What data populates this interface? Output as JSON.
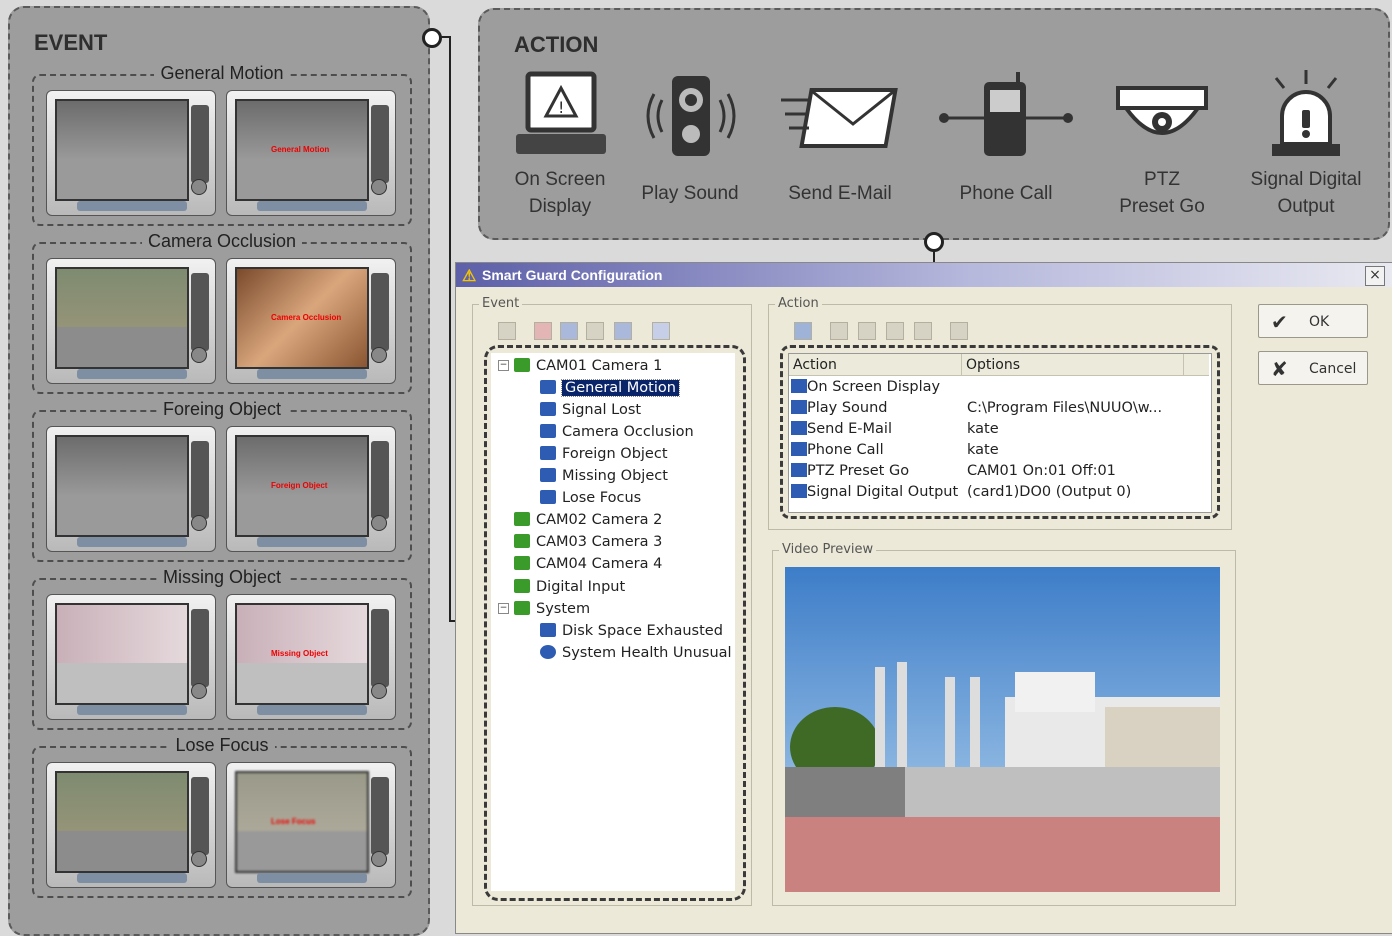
{
  "event_panel": {
    "title": "EVENT",
    "groups": [
      {
        "label": "General Motion",
        "tags": [
          "",
          "General Motion"
        ]
      },
      {
        "label": "Camera Occlusion",
        "tags": [
          "",
          "Camera Occlusion"
        ]
      },
      {
        "label": "Foreing Object",
        "tags": [
          "",
          "Foreign Object"
        ]
      },
      {
        "label": "Missing Object",
        "tags": [
          "",
          "Missing Object"
        ]
      },
      {
        "label": "Lose Focus",
        "tags": [
          "",
          "Lose Focus"
        ]
      }
    ]
  },
  "action_panel": {
    "title": "ACTION",
    "items": [
      {
        "line1": "On Screen",
        "line2": "Display",
        "icon": "laptop-warning-icon"
      },
      {
        "line1": "",
        "line2": "Play Sound",
        "icon": "speaker-icon"
      },
      {
        "line1": "",
        "line2": "Send E-Mail",
        "icon": "envelope-icon"
      },
      {
        "line1": "",
        "line2": "Phone Call",
        "icon": "phone-icon"
      },
      {
        "line1": "PTZ",
        "line2": "Preset Go",
        "icon": "ptz-camera-icon"
      },
      {
        "line1": "Signal Digital",
        "line2": "Output",
        "icon": "alarm-light-icon"
      }
    ]
  },
  "dialog": {
    "title": "Smart Guard Configuration",
    "close": "×",
    "event_frame": "Event",
    "action_frame": "Action",
    "preview_frame": "Video Preview",
    "ok": "OK",
    "cancel": "Cancel",
    "ok_glyph": "✔",
    "cancel_glyph": "✘",
    "tree": {
      "cam1": "CAM01 Camera 1",
      "cam1_children": [
        "General Motion",
        "Signal Lost",
        "Camera Occlusion",
        "Foreign Object",
        "Missing Object",
        "Lose Focus"
      ],
      "cam2": "CAM02 Camera 2",
      "cam3": "CAM03 Camera 3",
      "cam4": "CAM04 Camera 4",
      "digital_input": "Digital Input",
      "system": "System",
      "system_children": [
        "Disk Space Exhausted",
        "System Health Unusual"
      ]
    },
    "action_list": {
      "col_action": "Action",
      "col_options": "Options",
      "rows": [
        {
          "action": "On Screen Display",
          "options": ""
        },
        {
          "action": "Play Sound",
          "options": "C:\\Program Files\\NUUO\\w..."
        },
        {
          "action": "Send E-Mail",
          "options": "kate"
        },
        {
          "action": "Phone Call",
          "options": "kate"
        },
        {
          "action": "PTZ Preset Go",
          "options": "CAM01 On:01 Off:01"
        },
        {
          "action": "Signal Digital Output",
          "options": "(card1)DO0 (Output 0)"
        }
      ]
    }
  },
  "colors": {
    "panel": "#9d9d9d",
    "titlebar": "#5d5fa8",
    "selection": "#0a246a",
    "tree_green": "#3a9a2a"
  }
}
